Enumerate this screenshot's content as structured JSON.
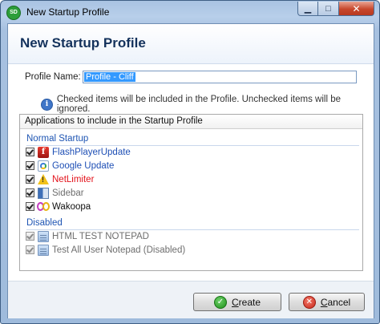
{
  "window": {
    "app_icon_text": "SD",
    "title": "New Startup Profile",
    "controls": {
      "minimize": "▁",
      "maximize": "□",
      "close": "✕"
    }
  },
  "header": {
    "title": "New Startup Profile"
  },
  "profile": {
    "label": "Profile Name:",
    "value": "Profile - Cliff"
  },
  "info": {
    "icon": "info-icon",
    "text": "Checked items will be included in the Profile. Unchecked items will be ignored."
  },
  "apps": {
    "header": "Applications to include in the Startup Profile",
    "groups": [
      {
        "label": "Normal Startup",
        "items": [
          {
            "label": "FlashPlayerUpdate",
            "checked": true,
            "icon": "flash-icon",
            "color": "#1e4fb5"
          },
          {
            "label": "Google Update",
            "checked": true,
            "icon": "google-update-icon",
            "color": "#1e4fb5"
          },
          {
            "label": "NetLimiter",
            "checked": true,
            "icon": "warning-icon",
            "color": "#e3121b"
          },
          {
            "label": "Sidebar",
            "checked": true,
            "icon": "sidebar-icon",
            "color": "#6e6e6e"
          },
          {
            "label": "Wakoopa",
            "checked": true,
            "icon": "wakoopa-icon",
            "color": "#111111"
          }
        ]
      },
      {
        "label": "Disabled",
        "items": [
          {
            "label": "HTML TEST NOTEPAD",
            "checked": true,
            "icon": "notepad-icon",
            "color": "#6e6e6e"
          },
          {
            "label": "Test All User Notepad (Disabled)",
            "checked": true,
            "icon": "notepad-icon",
            "color": "#6e6e6e"
          }
        ]
      }
    ]
  },
  "footer": {
    "create_prefix": "C",
    "create_rest": "reate",
    "cancel_prefix": "C",
    "cancel_rest": "ancel"
  }
}
